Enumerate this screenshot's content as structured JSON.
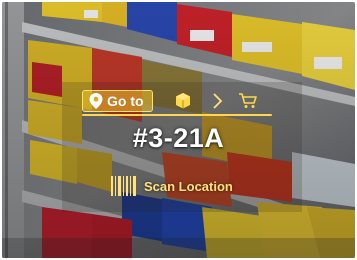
{
  "ar_nav": {
    "goto_label": "Go to",
    "icons": [
      "location-pin-icon",
      "package-box-icon",
      "chevron-right-icon",
      "shopping-cart-icon"
    ]
  },
  "location": {
    "code": "#3-21A"
  },
  "scan": {
    "label": "Scan Location",
    "icon": "barcode-icon"
  },
  "colors": {
    "accent": "#ffd84a",
    "label_text": "#ffe27a"
  }
}
